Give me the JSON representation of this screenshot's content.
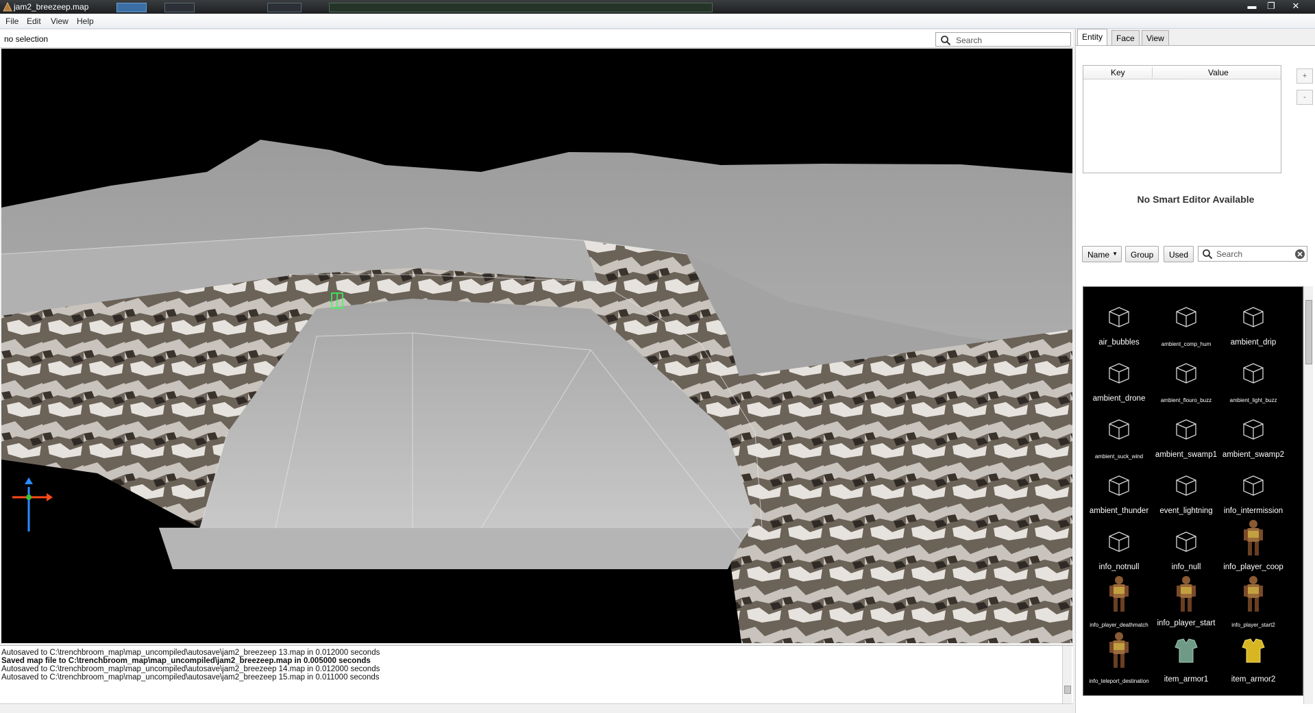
{
  "window": {
    "title": "jam2_breezeep.map",
    "minimize_glyph": "▬",
    "restore_glyph": "❐",
    "close_glyph": "✕"
  },
  "menu": {
    "items": [
      "File",
      "Edit",
      "View",
      "Help"
    ]
  },
  "map_view": {
    "selection_text": "no selection",
    "search_placeholder": "Search"
  },
  "console": {
    "lines": [
      {
        "text": "Autosaved to C:\\trenchbroom_map\\map_uncompiled\\autosave\\jam2_breezeep 13.map in 0.012000 seconds",
        "bold": false
      },
      {
        "text": "Saved map file to C:\\trenchbroom_map\\map_uncompiled\\jam2_breezeep.map in 0.005000 seconds",
        "bold": true
      },
      {
        "text": "Autosaved to C:\\trenchbroom_map\\map_uncompiled\\autosave\\jam2_breezeep 14.map in 0.012000 seconds",
        "bold": false
      },
      {
        "text": "Autosaved to C:\\trenchbroom_map\\map_uncompiled\\autosave\\jam2_breezeep 15.map in 0.011000 seconds",
        "bold": false
      }
    ]
  },
  "inspector": {
    "tabs": [
      "Entity",
      "Face",
      "View"
    ],
    "active_tab": "Entity",
    "table": {
      "key_header": "Key",
      "value_header": "Value"
    },
    "add_button": "+",
    "remove_button": "-",
    "smart_editor_text": "No Smart Editor Available",
    "sort_label": "Name",
    "group_label": "Group",
    "used_label": "Used",
    "search_placeholder": "Search"
  },
  "entity_browser": {
    "entities": [
      {
        "name": "air_bubbles",
        "size": "norm",
        "icon": "cube-icon"
      },
      {
        "name": "ambient_comp_hum",
        "size": "small",
        "icon": "cube-icon"
      },
      {
        "name": "ambient_drip",
        "size": "norm",
        "icon": "cube-icon"
      },
      {
        "name": "ambient_drone",
        "size": "norm",
        "icon": "cube-icon"
      },
      {
        "name": "ambient_flouro_buzz",
        "size": "small",
        "icon": "cube-icon"
      },
      {
        "name": "ambient_light_buzz",
        "size": "small",
        "icon": "cube-icon"
      },
      {
        "name": "ambient_suck_wind",
        "size": "small",
        "icon": "cube-icon"
      },
      {
        "name": "ambient_swamp1",
        "size": "norm",
        "icon": "cube-icon"
      },
      {
        "name": "ambient_swamp2",
        "size": "norm",
        "icon": "cube-icon"
      },
      {
        "name": "ambient_thunder",
        "size": "norm",
        "icon": "cube-icon"
      },
      {
        "name": "event_lightning",
        "size": "norm",
        "icon": "cube-icon"
      },
      {
        "name": "info_intermission",
        "size": "norm",
        "icon": "cube-icon"
      },
      {
        "name": "info_notnull",
        "size": "norm",
        "icon": "cube-icon"
      },
      {
        "name": "info_null",
        "size": "norm",
        "icon": "cube-icon"
      },
      {
        "name": "info_player_coop",
        "size": "norm",
        "icon": "player-model-icon"
      },
      {
        "name": "info_player_deathmatch",
        "size": "small",
        "icon": "player-model-icon"
      },
      {
        "name": "info_player_start",
        "size": "norm",
        "icon": "player-model-icon"
      },
      {
        "name": "info_player_start2",
        "size": "small",
        "icon": "player-model-icon"
      },
      {
        "name": "info_teleport_destination",
        "size": "small",
        "icon": "player-model-icon"
      },
      {
        "name": "item_armor1",
        "size": "norm",
        "icon": "green-armor-icon"
      },
      {
        "name": "item_armor2",
        "size": "norm",
        "icon": "yellow-armor-icon"
      }
    ]
  }
}
